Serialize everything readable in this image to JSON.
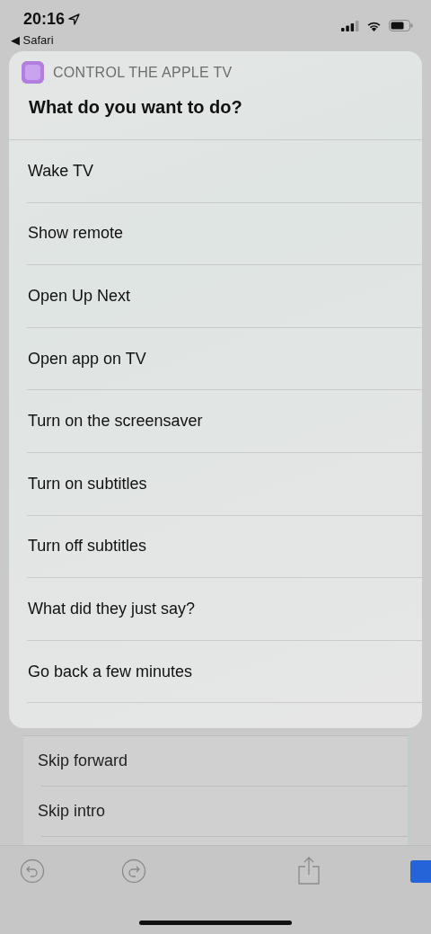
{
  "status_bar": {
    "time": "20:16",
    "back_link": "◀ Safari"
  },
  "sheet": {
    "app_name": "CONTROL THE APPLE TV",
    "prompt": "What do you want to do?",
    "options": [
      "Wake TV",
      "Show remote",
      "Open Up Next",
      "Open app on TV",
      "Turn on the screensaver",
      "Turn on subtitles",
      "Turn off subtitles",
      "What did they just say?",
      "Go back a few minutes"
    ]
  },
  "background_list": {
    "rows": [
      "Skip forward",
      "Skip intro"
    ]
  }
}
